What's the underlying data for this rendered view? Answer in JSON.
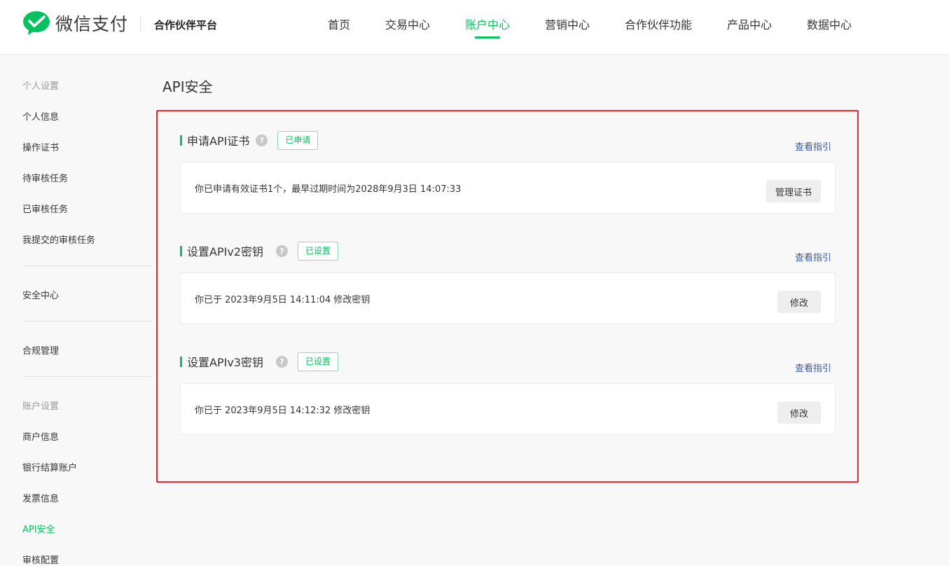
{
  "header": {
    "logo_text": "微信支付",
    "platform": "合作伙伴平台",
    "nav": [
      {
        "label": "首页"
      },
      {
        "label": "交易中心"
      },
      {
        "label": "账户中心",
        "active": true
      },
      {
        "label": "营销中心"
      },
      {
        "label": "合作伙伴功能"
      },
      {
        "label": "产品中心"
      },
      {
        "label": "数据中心"
      }
    ]
  },
  "sidebar": {
    "group_personal": "个人设置",
    "personal_items": [
      "个人信息",
      "操作证书",
      "待审核任务",
      "已审核任务",
      "我提交的审核任务"
    ],
    "security_center": "安全中心",
    "compliance": "合规管理",
    "group_account": "账户设置",
    "account_items": [
      "商户信息",
      "银行结算账户",
      "发票信息",
      "API安全",
      "审核配置"
    ]
  },
  "page": {
    "title": "API安全"
  },
  "sections": [
    {
      "title": "申请API证书",
      "badge": "已申请",
      "guide": "查看指引",
      "text": "你已申请有效证书1个，最早过期时间为2028年9月3日 14:07:33",
      "button": "管理证书"
    },
    {
      "title": "设置APIv2密钥",
      "badge": "已设置",
      "guide": "查看指引",
      "text": "你已于 2023年9月5日 14:11:04 修改密钥",
      "button": "修改"
    },
    {
      "title": "设置APIv3密钥",
      "badge": "已设置",
      "guide": "查看指引",
      "text": "你已于 2023年9月5日 14:12:32 修改密钥",
      "button": "修改"
    }
  ],
  "icons": {
    "help": "?",
    "brand_color": "#07c160",
    "highlight_color": "#f0262a"
  }
}
